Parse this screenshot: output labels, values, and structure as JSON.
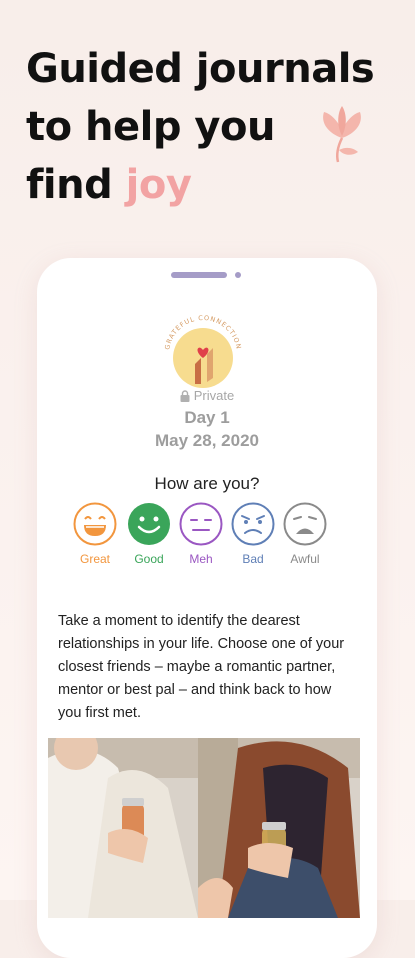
{
  "headline": {
    "line1": "Guided journals",
    "line2": "to help you",
    "line3_prefix": "find",
    "line3_accent": "joy"
  },
  "colors": {
    "accent": "#f2a3a3",
    "great": "#f2963e",
    "good": "#3aa55a",
    "meh": "#9a57c2",
    "bad": "#5f7fb6",
    "awful": "#8a8a8a"
  },
  "journal": {
    "badge_text": "GRATEFUL CONNECTION",
    "privacy": "Private",
    "day": "Day 1",
    "date": "May 28, 2020",
    "question": "How are you?",
    "moods": [
      {
        "label": "Great",
        "icon": "great-face-icon"
      },
      {
        "label": "Good",
        "icon": "good-face-icon"
      },
      {
        "label": "Meh",
        "icon": "meh-face-icon"
      },
      {
        "label": "Bad",
        "icon": "bad-face-icon"
      },
      {
        "label": "Awful",
        "icon": "awful-face-icon"
      }
    ],
    "prompt": "Take a moment to identify the dearest relationships in your life. Choose one of your closest friends – maybe a romantic partner, mentor or best pal – and think back to how you first met."
  }
}
